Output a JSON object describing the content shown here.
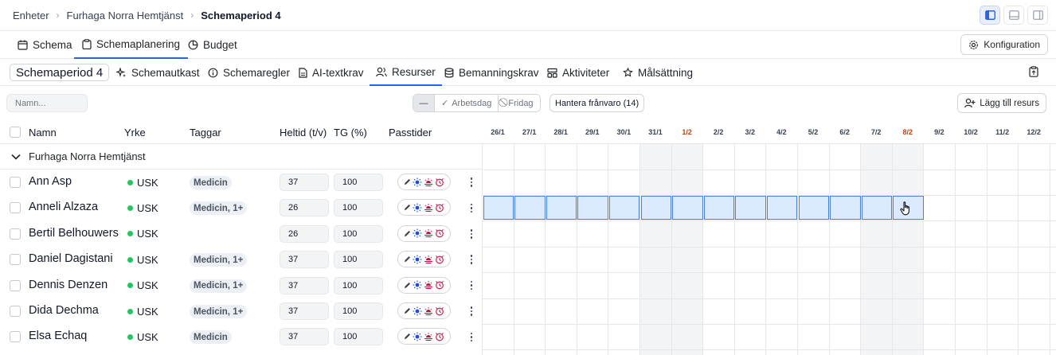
{
  "breadcrumb": [
    "Enheter",
    "Furhaga Norra Hemtjänst",
    "Schemaperiod 4"
  ],
  "main_tabs": [
    {
      "label": "Schema",
      "icon": "calendar-icon"
    },
    {
      "label": "Schemaplanering",
      "icon": "clipboard-icon",
      "active": true
    },
    {
      "label": "Budget",
      "icon": "pie-chart-icon"
    }
  ],
  "config_label": "Konfiguration",
  "period_label": "Schemaperiod 4",
  "sub_tabs": [
    {
      "label": "Schemautkast",
      "icon": "sparkle-icon"
    },
    {
      "label": "Schemaregler",
      "icon": "info-icon"
    },
    {
      "label": "AI-textkrav",
      "icon": "document-icon"
    },
    {
      "label": "Resurser",
      "icon": "users-icon",
      "active": true
    },
    {
      "label": "Bemanningskrav",
      "icon": "database-icon"
    },
    {
      "label": "Aktiviteter",
      "icon": "activity-icon"
    },
    {
      "label": "Målsättning",
      "icon": "target-icon"
    }
  ],
  "filters": {
    "search_placeholder": "Namn...",
    "segment_dash": "—",
    "segment_workday": "Arbetsdag",
    "segment_holiday": "Fridag",
    "absence_button": "Hantera frånvaro (14)",
    "add_resource": "Lägg till resurs"
  },
  "columns": {
    "name": "Namn",
    "yrke": "Yrke",
    "taggar": "Taggar",
    "heltid": "Heltid (t/v)",
    "tg": "TG (%)",
    "passtider": "Passtider"
  },
  "dates": [
    {
      "label": "26/1"
    },
    {
      "label": "27/1"
    },
    {
      "label": "28/1"
    },
    {
      "label": "29/1"
    },
    {
      "label": "30/1"
    },
    {
      "label": "31/1",
      "weekend": true
    },
    {
      "label": "1/2",
      "weekend": true,
      "red": true
    },
    {
      "label": "2/2"
    },
    {
      "label": "3/2"
    },
    {
      "label": "4/2"
    },
    {
      "label": "5/2"
    },
    {
      "label": "6/2"
    },
    {
      "label": "7/2",
      "weekend": true
    },
    {
      "label": "8/2",
      "weekend": true,
      "red": true
    },
    {
      "label": "9/2"
    },
    {
      "label": "10/2"
    },
    {
      "label": "11/2"
    },
    {
      "label": "12/2"
    }
  ],
  "group": "Furhaga Norra Hemtjänst",
  "rows": [
    {
      "name": "Ann Asp",
      "yrke": "USK",
      "tag": "Medicin",
      "heltid": "37",
      "tg": "100"
    },
    {
      "name": "Anneli Alzaza",
      "yrke": "USK",
      "tag": "Medicin, 1+",
      "heltid": "26",
      "tg": "100"
    },
    {
      "name": "Bertil Belhouwers",
      "yrke": "USK",
      "tag": "",
      "heltid": "26",
      "tg": "100"
    },
    {
      "name": "Daniel Dagistani",
      "yrke": "USK",
      "tag": "Medicin, 1+",
      "heltid": "37",
      "tg": "100"
    },
    {
      "name": "Dennis Denzen",
      "yrke": "USK",
      "tag": "Medicin, 1+",
      "heltid": "37",
      "tg": "100"
    },
    {
      "name": "Dida Dechma",
      "yrke": "USK",
      "tag": "Medicin, 1+",
      "heltid": "37",
      "tg": "100"
    },
    {
      "name": "Elsa Echaq",
      "yrke": "USK",
      "tag": "Medicin",
      "heltid": "37",
      "tg": "100"
    }
  ],
  "selection": {
    "row": 1,
    "from_date": "26/1",
    "to_date": "8/2"
  },
  "colors": {
    "accent": "#2563eb",
    "selected_fill": "#dbeafe",
    "selected_border": "#4a7fd8",
    "weekend_red": "#c2410c",
    "status_green": "#22c55e"
  }
}
